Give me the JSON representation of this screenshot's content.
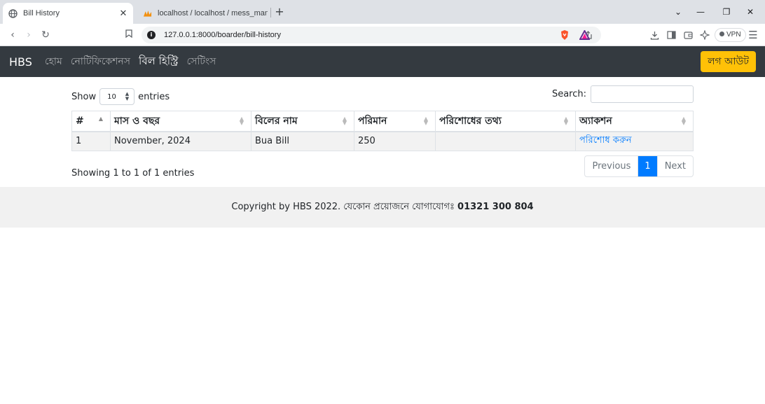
{
  "browser": {
    "tabs": [
      {
        "title": "Bill History"
      },
      {
        "title": "localhost / localhost / mess_manag"
      }
    ],
    "url": "127.0.0.1:8000/boarder/bill-history",
    "vpn_label": "VPN"
  },
  "navbar": {
    "brand": "HBS",
    "links": [
      "হোম",
      "নোটিফিকেশনস",
      "বিল হিস্ট্রি",
      "সেটিংস"
    ],
    "logout": "লগ আউট"
  },
  "table_controls": {
    "show_label": "Show",
    "page_size": "10",
    "entries_label": "entries",
    "search_label": "Search:"
  },
  "table": {
    "columns": [
      "#",
      "মাস ও বছর",
      "বিলের নাম",
      "পরিমান",
      "পরিশোধের তথ্য",
      "অ্যাকশন"
    ],
    "rows": [
      {
        "num": "1",
        "month": "November, 2024",
        "name": "Bua Bill",
        "amount": "250",
        "payment_info": "",
        "action": "পরিশোধ করুন"
      }
    ]
  },
  "pagination": {
    "info": "Showing 1 to 1 of 1 entries",
    "previous": "Previous",
    "current": "1",
    "next": "Next"
  },
  "footer": {
    "text": "Copyright by HBS 2022. যেকোন প্রয়োজনে যোগাযোগঃ",
    "phone": "01321 300 804"
  }
}
